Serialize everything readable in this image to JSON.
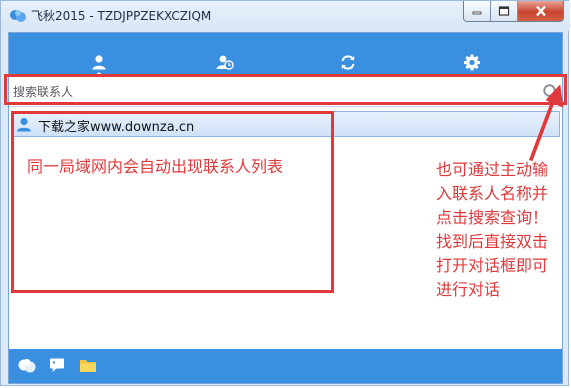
{
  "window": {
    "title": "飞秋2015 - TZDJPPZEKXCZIQM"
  },
  "title_buttons": {
    "minimize": "minimize",
    "maximize": "maximize",
    "close": "close"
  },
  "nav": {
    "tabs": [
      {
        "icon": "user-icon",
        "active": true
      },
      {
        "icon": "recent-contacts-icon",
        "active": false
      },
      {
        "icon": "refresh-icon",
        "active": false
      },
      {
        "icon": "settings-icon",
        "active": false
      }
    ]
  },
  "search": {
    "placeholder": "搜索联系人",
    "icon": "search-icon"
  },
  "contacts": [
    {
      "name": "下载之家www.downza.cn",
      "icon": "user-icon"
    }
  ],
  "annotations": {
    "list_note": "同一局域网内会自动出现联系人列表",
    "search_note_lines": [
      "也可通过主动输",
      "入联系人名称并",
      "点击搜索查询！",
      "找到后直接双击",
      "打开对话框即可",
      "进行对话"
    ]
  },
  "bottom_bar": {
    "icons": [
      "app-logo-icon",
      "message-icon",
      "folder-icon"
    ]
  },
  "colors": {
    "accent": "#3a8fe0",
    "annotation": "#e0393b",
    "selection": "#cfe2f8"
  }
}
